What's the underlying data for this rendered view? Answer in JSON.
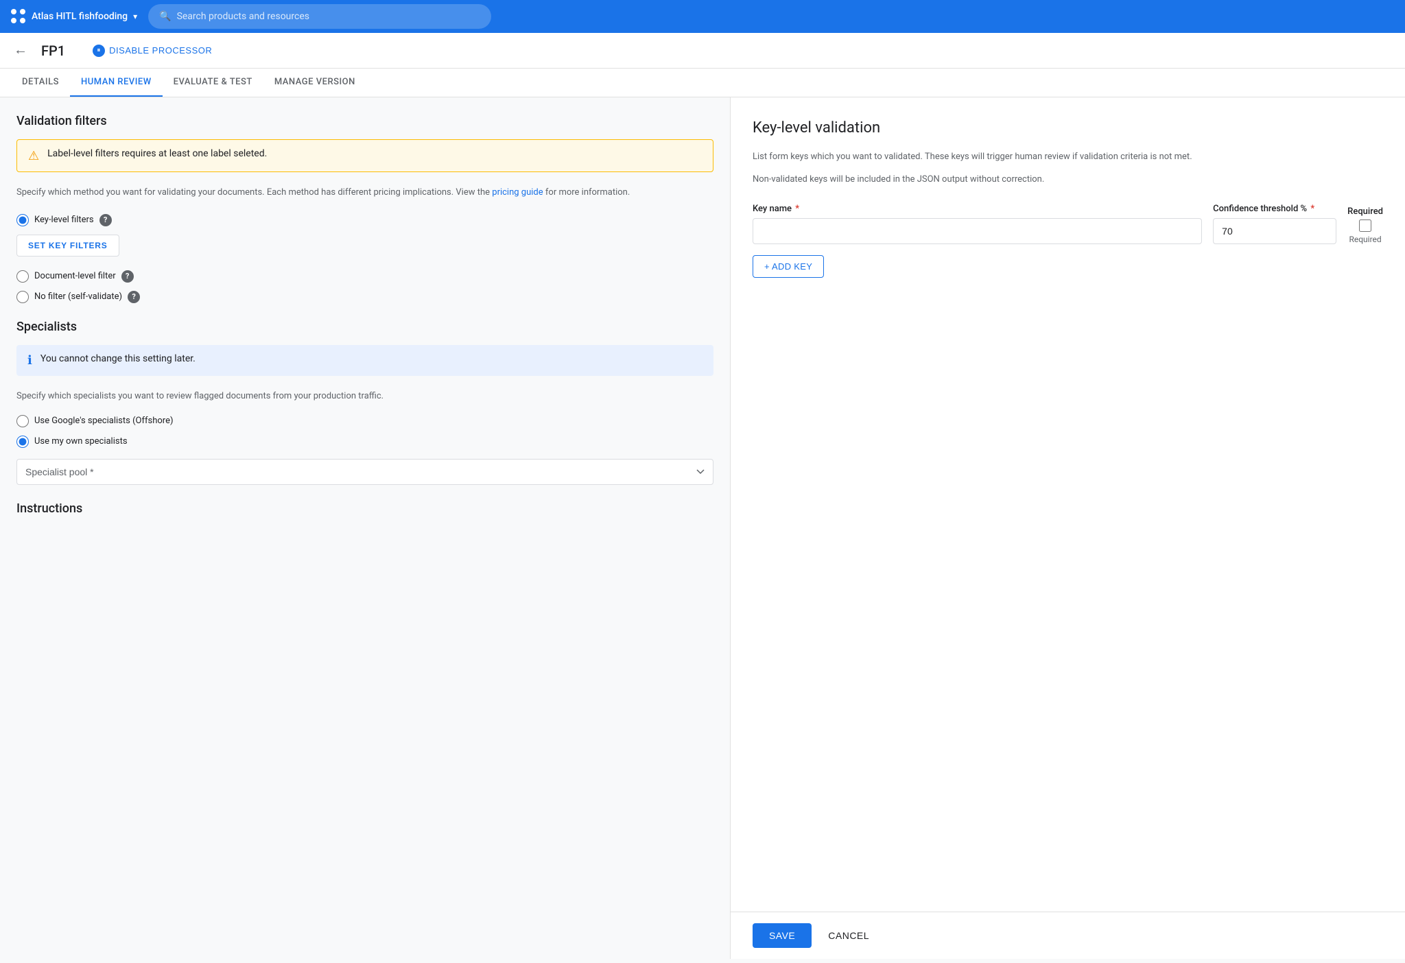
{
  "topNav": {
    "appName": "Atlas HITL fishfooding",
    "searchPlaceholder": "Search products and resources"
  },
  "secondaryNav": {
    "pageTitle": "FP1",
    "disableProcessorLabel": "DISABLE PROCESSOR"
  },
  "tabs": [
    {
      "id": "details",
      "label": "DETAILS",
      "active": false
    },
    {
      "id": "human-review",
      "label": "HUMAN REVIEW",
      "active": true
    },
    {
      "id": "evaluate-test",
      "label": "EVALUATE & TEST",
      "active": false
    },
    {
      "id": "manage-version",
      "label": "MANAGE VERSION",
      "active": false
    }
  ],
  "leftPanel": {
    "validationFilters": {
      "sectionTitle": "Validation filters",
      "warningMessage": "Label-level filters requires at least one label seleted.",
      "description": "Specify which method you want for validating your documents. Each method has different pricing implications. View the ",
      "pricingLinkText": "pricing guide",
      "descriptionSuffix": " for more information.",
      "radioOptions": [
        {
          "id": "key-level",
          "label": "Key-level filters",
          "checked": true,
          "hasHelp": true
        },
        {
          "id": "document-level",
          "label": "Document-level filter",
          "checked": false,
          "hasHelp": true
        },
        {
          "id": "no-filter",
          "label": "No filter (self-validate)",
          "checked": false,
          "hasHelp": true
        }
      ],
      "setKeyFiltersLabel": "SET KEY FILTERS"
    },
    "specialists": {
      "sectionTitle": "Specialists",
      "infoMessage": "You cannot change this setting later.",
      "description": "Specify which specialists you want to review flagged documents from your production traffic.",
      "specialistOptions": [
        {
          "id": "google-offshore",
          "label": "Use Google's specialists (Offshore)",
          "checked": false
        },
        {
          "id": "own-specialists",
          "label": "Use my own specialists",
          "checked": true
        }
      ],
      "specialistPoolLabel": "Specialist pool",
      "specialistPoolRequired": true,
      "specialistPoolPlaceholder": "Specialist pool *"
    },
    "instructions": {
      "sectionTitle": "Instructions"
    }
  },
  "rightPanel": {
    "title": "Key-level validation",
    "description1": "List form keys which you want to validated. These keys will trigger human review if validation criteria is not met.",
    "description2": "Non-validated keys will be included in the JSON output without correction.",
    "keyNameLabel": "Key name",
    "keyNameRequired": true,
    "confidenceLabel": "Confidence threshold %",
    "confidenceRequired": true,
    "confidenceValue": "70",
    "requiredLabel": "Required",
    "addKeyLabel": "+ ADD KEY",
    "saveLabel": "SAVE",
    "cancelLabel": "CANCEL"
  }
}
